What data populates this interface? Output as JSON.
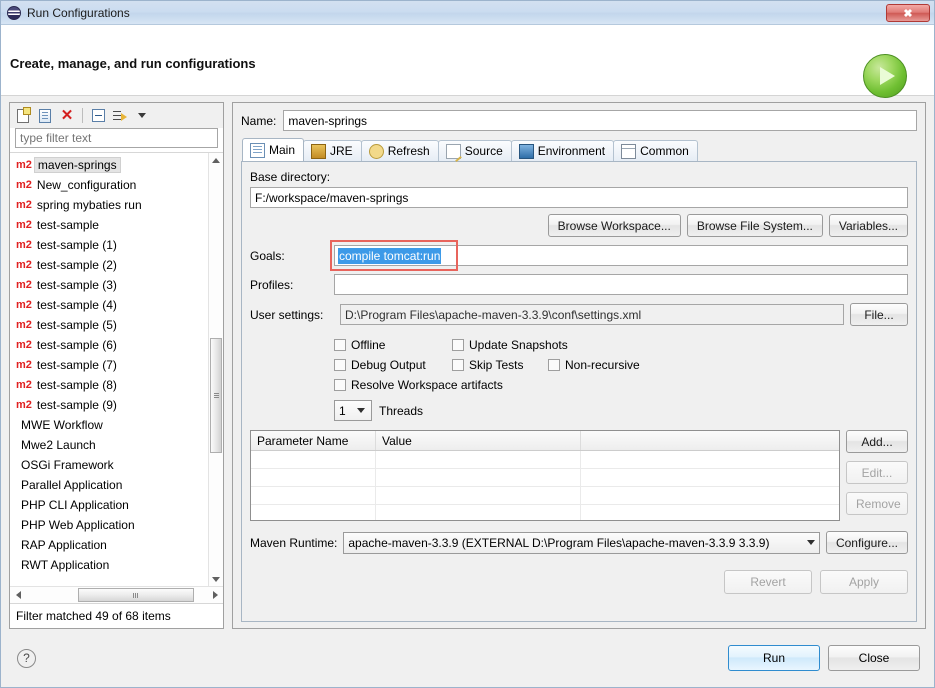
{
  "window": {
    "title": "Run Configurations",
    "icon": "eclipse-run-icon",
    "close_label": "✖"
  },
  "header": {
    "title": "Create, manage, and run configurations",
    "icon": "run-play-icon"
  },
  "sidebar": {
    "toolbar": [
      {
        "name": "new-configuration-icon",
        "tooltip": "New launch configuration"
      },
      {
        "name": "duplicate-configuration-icon",
        "tooltip": "Duplicate"
      },
      {
        "name": "delete-configuration-icon",
        "tooltip": "Delete"
      },
      {
        "name": "collapse-all-icon",
        "tooltip": "Collapse All"
      },
      {
        "name": "filter-icon",
        "tooltip": "Filter"
      },
      {
        "name": "view-menu-caret-icon",
        "tooltip": "View Menu"
      }
    ],
    "filter": {
      "placeholder": "type filter text",
      "value": ""
    },
    "items": [
      {
        "label": "maven-springs",
        "badge": "m2",
        "selected": true
      },
      {
        "label": "New_configuration",
        "badge": "m2",
        "selected": false
      },
      {
        "label": "spring mybaties run",
        "badge": "m2",
        "selected": false
      },
      {
        "label": "test-sample",
        "badge": "m2",
        "selected": false
      },
      {
        "label": "test-sample (1)",
        "badge": "m2",
        "selected": false
      },
      {
        "label": "test-sample (2)",
        "badge": "m2",
        "selected": false
      },
      {
        "label": "test-sample (3)",
        "badge": "m2",
        "selected": false
      },
      {
        "label": "test-sample (4)",
        "badge": "m2",
        "selected": false
      },
      {
        "label": "test-sample (5)",
        "badge": "m2",
        "selected": false
      },
      {
        "label": "test-sample (6)",
        "badge": "m2",
        "selected": false
      },
      {
        "label": "test-sample (7)",
        "badge": "m2",
        "selected": false
      },
      {
        "label": "test-sample (8)",
        "badge": "m2",
        "selected": false
      },
      {
        "label": "test-sample (9)",
        "badge": "m2",
        "selected": false
      },
      {
        "label": "MWE Workflow",
        "badge": "",
        "selected": false
      },
      {
        "label": "Mwe2 Launch",
        "badge": "",
        "selected": false
      },
      {
        "label": "OSGi Framework",
        "badge": "",
        "selected": false
      },
      {
        "label": "Parallel Application",
        "badge": "",
        "selected": false
      },
      {
        "label": "PHP CLI Application",
        "badge": "",
        "selected": false
      },
      {
        "label": "PHP Web Application",
        "badge": "",
        "selected": false
      },
      {
        "label": "RAP Application",
        "badge": "",
        "selected": false
      },
      {
        "label": "RWT Application",
        "badge": "",
        "selected": false
      }
    ],
    "status": "Filter matched 49 of 68 items"
  },
  "main": {
    "name_label": "Name:",
    "name_value": "maven-springs",
    "tabs": [
      {
        "label": "Main",
        "icon": "main-tab-icon",
        "active": true
      },
      {
        "label": "JRE",
        "icon": "jre-tab-icon",
        "active": false
      },
      {
        "label": "Refresh",
        "icon": "refresh-tab-icon",
        "active": false
      },
      {
        "label": "Source",
        "icon": "source-tab-icon",
        "active": false
      },
      {
        "label": "Environment",
        "icon": "environment-tab-icon",
        "active": false
      },
      {
        "label": "Common",
        "icon": "common-tab-icon",
        "active": false
      }
    ],
    "base_directory_label": "Base directory:",
    "base_directory_value": "F:/workspace/maven-springs",
    "browse_workspace_label": "Browse Workspace...",
    "browse_filesystem_label": "Browse File System...",
    "variables_label": "Variables...",
    "goals_label": "Goals:",
    "goals_value": "compile tomcat:run",
    "goals_selected": true,
    "goals_highlight_color": "#3d9ae8",
    "annotation_color": "#e8645c",
    "profiles_label": "Profiles:",
    "profiles_value": "",
    "user_settings_label": "User settings:",
    "user_settings_value": "D:\\Program Files\\apache-maven-3.3.9\\conf\\settings.xml",
    "file_button_label": "File...",
    "checkboxes": [
      {
        "label": "Offline",
        "checked": false
      },
      {
        "label": "Update Snapshots",
        "checked": false
      },
      {
        "label": "Debug Output",
        "checked": false
      },
      {
        "label": "Skip Tests",
        "checked": false
      },
      {
        "label": "Non-recursive",
        "checked": false
      },
      {
        "label": "Resolve Workspace artifacts",
        "checked": false
      }
    ],
    "threads_value": "1",
    "threads_label": "Threads",
    "table": {
      "columns": [
        "Parameter Name",
        "Value",
        ""
      ],
      "rows": [],
      "empty_row_count": 4
    },
    "table_buttons": [
      {
        "label": "Add...",
        "enabled": true
      },
      {
        "label": "Edit...",
        "enabled": false
      },
      {
        "label": "Remove",
        "enabled": false
      }
    ],
    "maven_runtime_label": "Maven Runtime:",
    "maven_runtime_value": "apache-maven-3.3.9 (EXTERNAL D:\\Program Files\\apache-maven-3.3.9 3.3.9)",
    "configure_label": "Configure...",
    "revert_label": "Revert",
    "apply_label": "Apply"
  },
  "footer": {
    "help_label": "?",
    "run_label": "Run",
    "close_label": "Close"
  }
}
